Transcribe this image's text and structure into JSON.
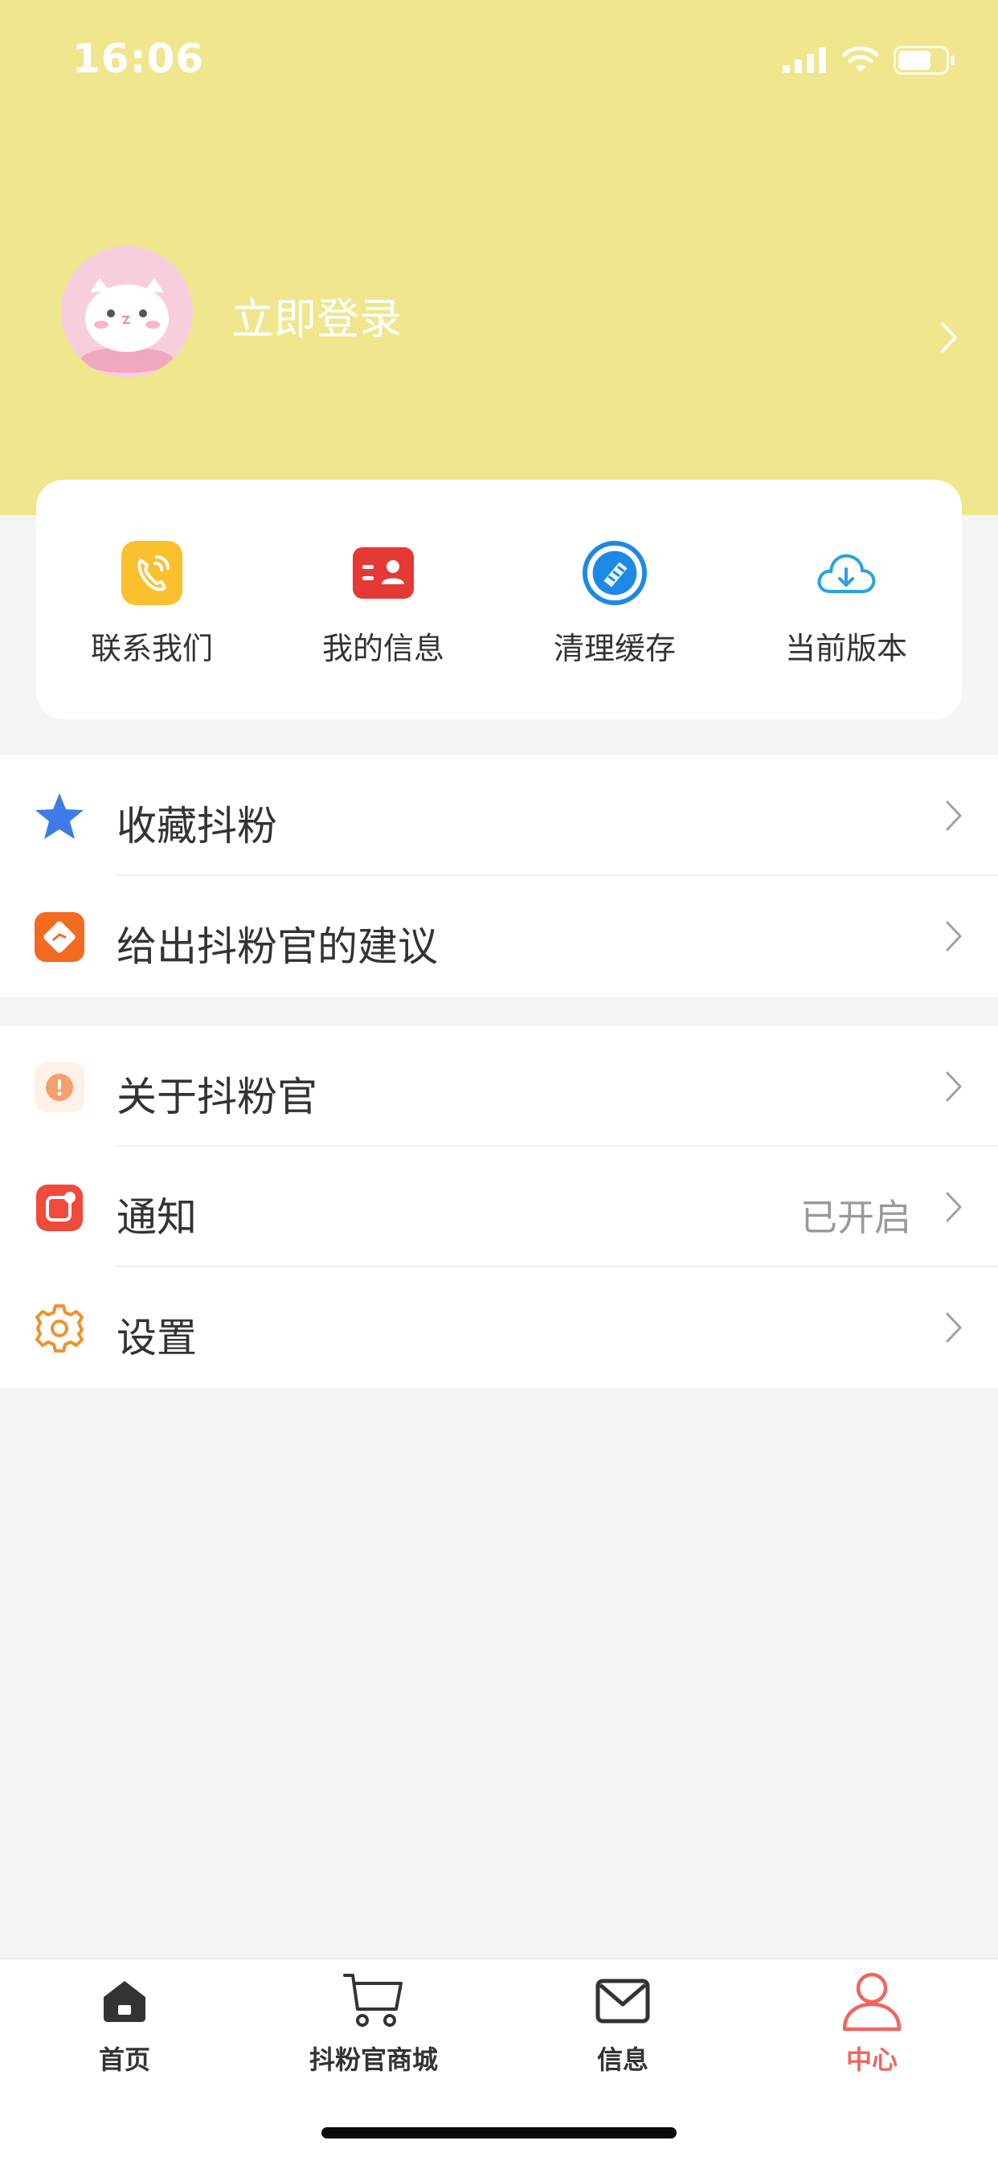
{
  "status_bar": {
    "time": "16:06"
  },
  "header": {
    "login_text": "立即登录"
  },
  "quick_actions": [
    {
      "label": "联系我们",
      "icon": "phone-icon",
      "color": "#fbc02d"
    },
    {
      "label": "我的信息",
      "icon": "id-card-icon",
      "color": "#e53935"
    },
    {
      "label": "清理缓存",
      "icon": "broom-icon",
      "color": "#1e88e5"
    },
    {
      "label": "当前版本",
      "icon": "cloud-download-icon",
      "color": "#29a3e0"
    }
  ],
  "menu_section_1": [
    {
      "label": "收藏抖粉",
      "icon": "star-icon"
    },
    {
      "label": "给出抖粉官的建议",
      "icon": "feedback-icon"
    }
  ],
  "menu_section_2": [
    {
      "label": "关于抖粉官",
      "icon": "info-icon"
    },
    {
      "label": "通知",
      "icon": "notification-icon",
      "value": "已开启"
    },
    {
      "label": "设置",
      "icon": "gear-icon"
    }
  ],
  "tabbar": {
    "tabs": [
      {
        "label": "首页",
        "icon": "home-icon"
      },
      {
        "label": "抖粉官商城",
        "icon": "cart-icon"
      },
      {
        "label": "信息",
        "icon": "mail-icon"
      },
      {
        "label": "中心",
        "icon": "user-icon"
      }
    ],
    "active_color": "#f06560"
  },
  "colors": {
    "header_bg": "#efe68e",
    "page_bg": "#f5f5f5"
  }
}
